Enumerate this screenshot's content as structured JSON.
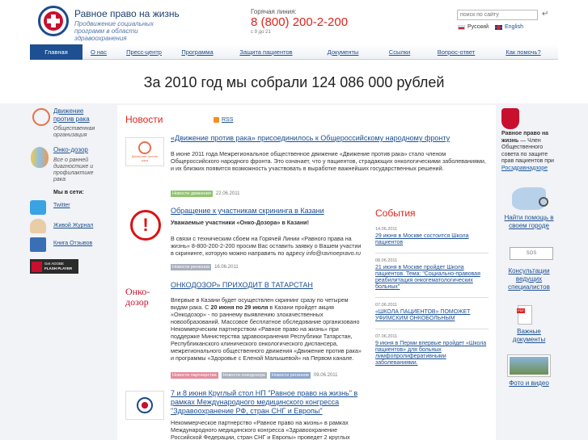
{
  "header": {
    "title": "Равное право на жизнь",
    "subtitle": "Продвижение социальных программ в области здравоохранения",
    "hotline_label": "Горячая линия:",
    "hotline_number": "8 (800) 200-2-200",
    "hotline_hours": "с 9 до 21",
    "search_placeholder": "поиск по сайту",
    "lang_ru": "Русский",
    "lang_en": "English"
  },
  "nav": [
    "Главная",
    "О нас",
    "Пресс-центр",
    "Программа",
    "Защита пациентов",
    "Документы",
    "Ссылки",
    "Вопрос-ответ",
    "Как помочь?"
  ],
  "banner": "За 2010 год мы собрали 124 086 000 рублей",
  "left": {
    "org1_title": "Движение против рака",
    "org1_sub": "Общественная организация",
    "org2_title": "Онко-дозор",
    "org2_sub": "Все о ранней диагностике и профилактике рака",
    "social_heading": "Мы в сети:",
    "twitter": "Twitter",
    "livejournal": "Живой Журнал",
    "reviews": "Книга Отзывов",
    "flash_line1": "Get ADOBE",
    "flash_line2": "FLASH PLAYER"
  },
  "news": {
    "heading": "Новости",
    "rss": "RSS",
    "items": [
      {
        "title": "«Движение против рака» присоединилось к Общероссийскому народному фронту",
        "body": "В июне 2011 года Межрегиональное общественное движение «Движение против рака» стало членом Общероссийского народного фронта. Это означает, что у пациентов, страдающих онкологическими заболеваниями, и их близких появится возможность участвовать в выработке важнейших государственных решений.",
        "tag": "Новости движения",
        "date": "22.06.2011"
      },
      {
        "title": "Обращение к участникам скрининга в Казани",
        "bold": "Уважаемые участники «Онко-Дозора» в Казани!",
        "body": "В связи с техническим сбоем на Горячей Линии «Равного права на жизнь» 8-800-200-2-200 просим Вас оставить заявку о Вашем участии в скрининге, которую можно направить по адресу",
        "email": "info@ravnoepravo.ru",
        "tag": "Новости регионов",
        "date": "16.06.2011"
      },
      {
        "title": "ОНКОДОЗОР» ПРИХОДИТ В ТАТАРСТАН",
        "body_a": "Впервые в Казани будет осуществлен скрининг сразу по четырем видам рака. С",
        "body_bold": "20 июня по 29 июля",
        "body_b": "в Казани пройдет акция «Онкодозор» - по раннему выявлению злокачественных новообразований. Массовое бесплатное обследование организовано Некоммерческим партнерством «Равное право на жизнь» при поддержке Министерства здравоохранения Республики Татарстан, Республиканского клинического онкологического диспансера, межрегионального общественного движения «Движение против рака» и программы «Здоровье с Еленой Малышевой» на Первом канале.",
        "tags": [
          "Новости партнерства",
          "Новости онкодозора",
          "Новости регионов"
        ],
        "date": "09.06.2011"
      },
      {
        "title": "7 и 8 июня Круглый стол НП \"Равное право на жизнь\" в рамках Международного медицинского конгресса \"Здравоохранение РФ, стран СНГ и Европы\"",
        "body": "Некоммерческое партнерство «Равное право на жизнь» в рамках Международного медицинского конгресса «Здравоохранение Российской Федерации, стран СНГ и Европы» проведет 2 круглых"
      }
    ],
    "logo1_text": "Движение против рака",
    "logo3_text_a": "Онко-",
    "logo3_text_b": "дозор"
  },
  "events": {
    "heading": "События",
    "items": [
      {
        "date": "14.06.2011",
        "title": "29 июня в Москве состоится Школа пациентов"
      },
      {
        "date": "08.06.2011",
        "title": "21 июня в Москве пройдет Школа пациентов. Тема: \"Социально-правовая реабилитация онкогематологических больных\""
      },
      {
        "date": "07.06.2011",
        "title": "«ШКОЛА ПАЦИЕНТОВ» ПОМОЖЕТ УФИМСКИМ ОНКОБОЛЬНЫМ"
      },
      {
        "date": "07.06.2011",
        "title": "9 июня в Перми впервые пройдет «Школа пациентов» для больных лимфопролиферативными заболеваниями."
      }
    ]
  },
  "right": {
    "council_bold": "Равное право на жизнь",
    "council_text": "— Член Общественного совета по защите прав пациентов при",
    "council_link": "Росздравнадзоре",
    "find_help": "Найти помощь в своем городе",
    "consult": "Консультации ведущих специалистов",
    "sos": "SOS",
    "docs": "Важные документы",
    "photo": "Фото и видео",
    "pdf": "PDF"
  },
  "colors": {
    "brand_blue": "#1d4f91",
    "accent_red": "#e0241b"
  }
}
